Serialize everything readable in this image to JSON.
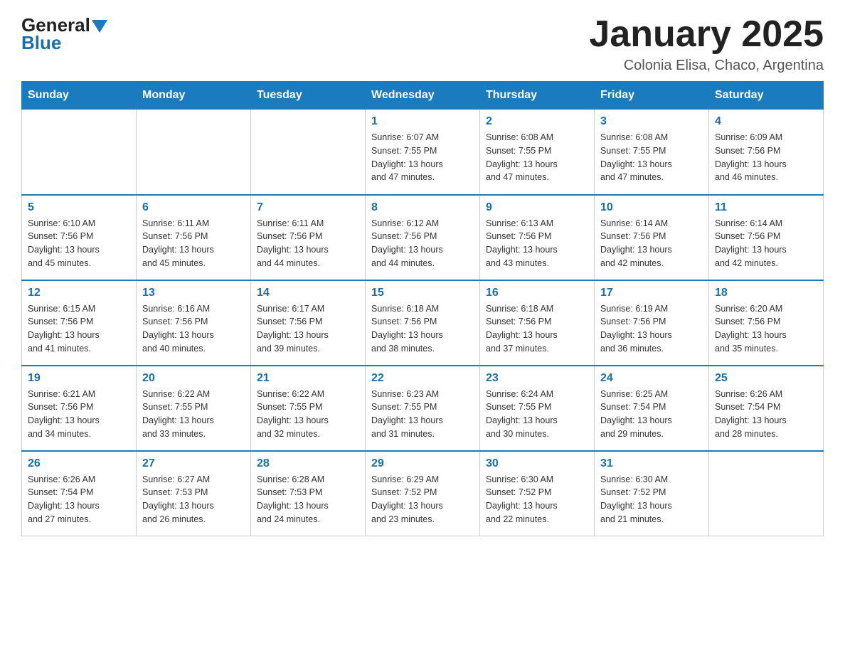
{
  "header": {
    "logo": {
      "general": "General",
      "blue": "Blue"
    },
    "title": "January 2025",
    "subtitle": "Colonia Elisa, Chaco, Argentina"
  },
  "weekdays": [
    "Sunday",
    "Monday",
    "Tuesday",
    "Wednesday",
    "Thursday",
    "Friday",
    "Saturday"
  ],
  "weeks": [
    [
      {
        "day": "",
        "info": ""
      },
      {
        "day": "",
        "info": ""
      },
      {
        "day": "",
        "info": ""
      },
      {
        "day": "1",
        "info": "Sunrise: 6:07 AM\nSunset: 7:55 PM\nDaylight: 13 hours\nand 47 minutes."
      },
      {
        "day": "2",
        "info": "Sunrise: 6:08 AM\nSunset: 7:55 PM\nDaylight: 13 hours\nand 47 minutes."
      },
      {
        "day": "3",
        "info": "Sunrise: 6:08 AM\nSunset: 7:55 PM\nDaylight: 13 hours\nand 47 minutes."
      },
      {
        "day": "4",
        "info": "Sunrise: 6:09 AM\nSunset: 7:56 PM\nDaylight: 13 hours\nand 46 minutes."
      }
    ],
    [
      {
        "day": "5",
        "info": "Sunrise: 6:10 AM\nSunset: 7:56 PM\nDaylight: 13 hours\nand 45 minutes."
      },
      {
        "day": "6",
        "info": "Sunrise: 6:11 AM\nSunset: 7:56 PM\nDaylight: 13 hours\nand 45 minutes."
      },
      {
        "day": "7",
        "info": "Sunrise: 6:11 AM\nSunset: 7:56 PM\nDaylight: 13 hours\nand 44 minutes."
      },
      {
        "day": "8",
        "info": "Sunrise: 6:12 AM\nSunset: 7:56 PM\nDaylight: 13 hours\nand 44 minutes."
      },
      {
        "day": "9",
        "info": "Sunrise: 6:13 AM\nSunset: 7:56 PM\nDaylight: 13 hours\nand 43 minutes."
      },
      {
        "day": "10",
        "info": "Sunrise: 6:14 AM\nSunset: 7:56 PM\nDaylight: 13 hours\nand 42 minutes."
      },
      {
        "day": "11",
        "info": "Sunrise: 6:14 AM\nSunset: 7:56 PM\nDaylight: 13 hours\nand 42 minutes."
      }
    ],
    [
      {
        "day": "12",
        "info": "Sunrise: 6:15 AM\nSunset: 7:56 PM\nDaylight: 13 hours\nand 41 minutes."
      },
      {
        "day": "13",
        "info": "Sunrise: 6:16 AM\nSunset: 7:56 PM\nDaylight: 13 hours\nand 40 minutes."
      },
      {
        "day": "14",
        "info": "Sunrise: 6:17 AM\nSunset: 7:56 PM\nDaylight: 13 hours\nand 39 minutes."
      },
      {
        "day": "15",
        "info": "Sunrise: 6:18 AM\nSunset: 7:56 PM\nDaylight: 13 hours\nand 38 minutes."
      },
      {
        "day": "16",
        "info": "Sunrise: 6:18 AM\nSunset: 7:56 PM\nDaylight: 13 hours\nand 37 minutes."
      },
      {
        "day": "17",
        "info": "Sunrise: 6:19 AM\nSunset: 7:56 PM\nDaylight: 13 hours\nand 36 minutes."
      },
      {
        "day": "18",
        "info": "Sunrise: 6:20 AM\nSunset: 7:56 PM\nDaylight: 13 hours\nand 35 minutes."
      }
    ],
    [
      {
        "day": "19",
        "info": "Sunrise: 6:21 AM\nSunset: 7:56 PM\nDaylight: 13 hours\nand 34 minutes."
      },
      {
        "day": "20",
        "info": "Sunrise: 6:22 AM\nSunset: 7:55 PM\nDaylight: 13 hours\nand 33 minutes."
      },
      {
        "day": "21",
        "info": "Sunrise: 6:22 AM\nSunset: 7:55 PM\nDaylight: 13 hours\nand 32 minutes."
      },
      {
        "day": "22",
        "info": "Sunrise: 6:23 AM\nSunset: 7:55 PM\nDaylight: 13 hours\nand 31 minutes."
      },
      {
        "day": "23",
        "info": "Sunrise: 6:24 AM\nSunset: 7:55 PM\nDaylight: 13 hours\nand 30 minutes."
      },
      {
        "day": "24",
        "info": "Sunrise: 6:25 AM\nSunset: 7:54 PM\nDaylight: 13 hours\nand 29 minutes."
      },
      {
        "day": "25",
        "info": "Sunrise: 6:26 AM\nSunset: 7:54 PM\nDaylight: 13 hours\nand 28 minutes."
      }
    ],
    [
      {
        "day": "26",
        "info": "Sunrise: 6:26 AM\nSunset: 7:54 PM\nDaylight: 13 hours\nand 27 minutes."
      },
      {
        "day": "27",
        "info": "Sunrise: 6:27 AM\nSunset: 7:53 PM\nDaylight: 13 hours\nand 26 minutes."
      },
      {
        "day": "28",
        "info": "Sunrise: 6:28 AM\nSunset: 7:53 PM\nDaylight: 13 hours\nand 24 minutes."
      },
      {
        "day": "29",
        "info": "Sunrise: 6:29 AM\nSunset: 7:52 PM\nDaylight: 13 hours\nand 23 minutes."
      },
      {
        "day": "30",
        "info": "Sunrise: 6:30 AM\nSunset: 7:52 PM\nDaylight: 13 hours\nand 22 minutes."
      },
      {
        "day": "31",
        "info": "Sunrise: 6:30 AM\nSunset: 7:52 PM\nDaylight: 13 hours\nand 21 minutes."
      },
      {
        "day": "",
        "info": ""
      }
    ]
  ]
}
